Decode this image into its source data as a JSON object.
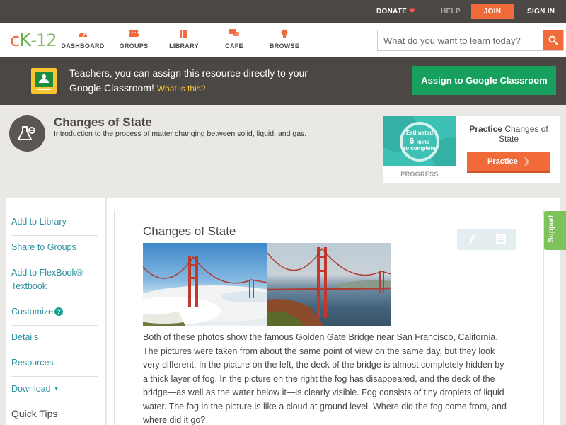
{
  "topbar": {
    "donate": "DONATE",
    "help": "HELP",
    "join": "JOIN",
    "signin": "SIGN IN"
  },
  "nav": {
    "logo_c": "c",
    "logo_k": "K",
    "logo_num": "-12",
    "items": [
      {
        "label": "DASHBOARD",
        "icon": "gauge-icon"
      },
      {
        "label": "GROUPS",
        "icon": "groups-icon"
      },
      {
        "label": "LIBRARY",
        "icon": "library-icon"
      },
      {
        "label": "CAFE",
        "icon": "chat-icon"
      },
      {
        "label": "BROWSE",
        "icon": "lightbulb-icon"
      }
    ],
    "search_placeholder": "What do you want to learn today?"
  },
  "banner": {
    "text": "Teachers, you can assign this resource directly to your Google Classroom!",
    "link": "What is this?",
    "button": "Assign to Google Classroom"
  },
  "concept": {
    "title": "Changes of State",
    "description": "Introduction to the process of matter changing between solid, liquid, and gas."
  },
  "practice": {
    "estimated": "Estimated",
    "minutes": "6",
    "mins_label": "mins",
    "to_complete": "to complete",
    "progress_label": "PROGRESS",
    "title_bold": "Practice",
    "title_rest": "Changes of State",
    "button": "Practice"
  },
  "sidebar": {
    "items": [
      {
        "label": "Add to Library"
      },
      {
        "label": "Share to Groups"
      },
      {
        "label": "Add to FlexBook® Textbook"
      },
      {
        "label": "Customize"
      },
      {
        "label": "Details"
      },
      {
        "label": "Resources"
      },
      {
        "label": "Download"
      }
    ],
    "quick_tips": "Quick Tips"
  },
  "article": {
    "title": "Changes of State",
    "body": "Both of these photos show the famous Golden Gate Bridge near San Francisco, California. The pictures were taken from about the same point of view on the same day, but they look very different. In the picture on the left, the deck of the bridge is almost completely hidden by a thick layer of fog. In the picture on the right the fog has disappeared, and the deck of the bridge—as well as the water below it—is clearly visible. Fog consists of tiny droplets of liquid water. The fog in the picture is like a cloud at ground level. Where did the fog come from, and where did it go?"
  },
  "support": "Support",
  "colors": {
    "brand_orange": "#f16b3a",
    "brand_green": "#6ab24d",
    "classroom_green": "#17a05d",
    "link_teal": "#2a8fa0",
    "dark_bar": "#4a4745"
  }
}
